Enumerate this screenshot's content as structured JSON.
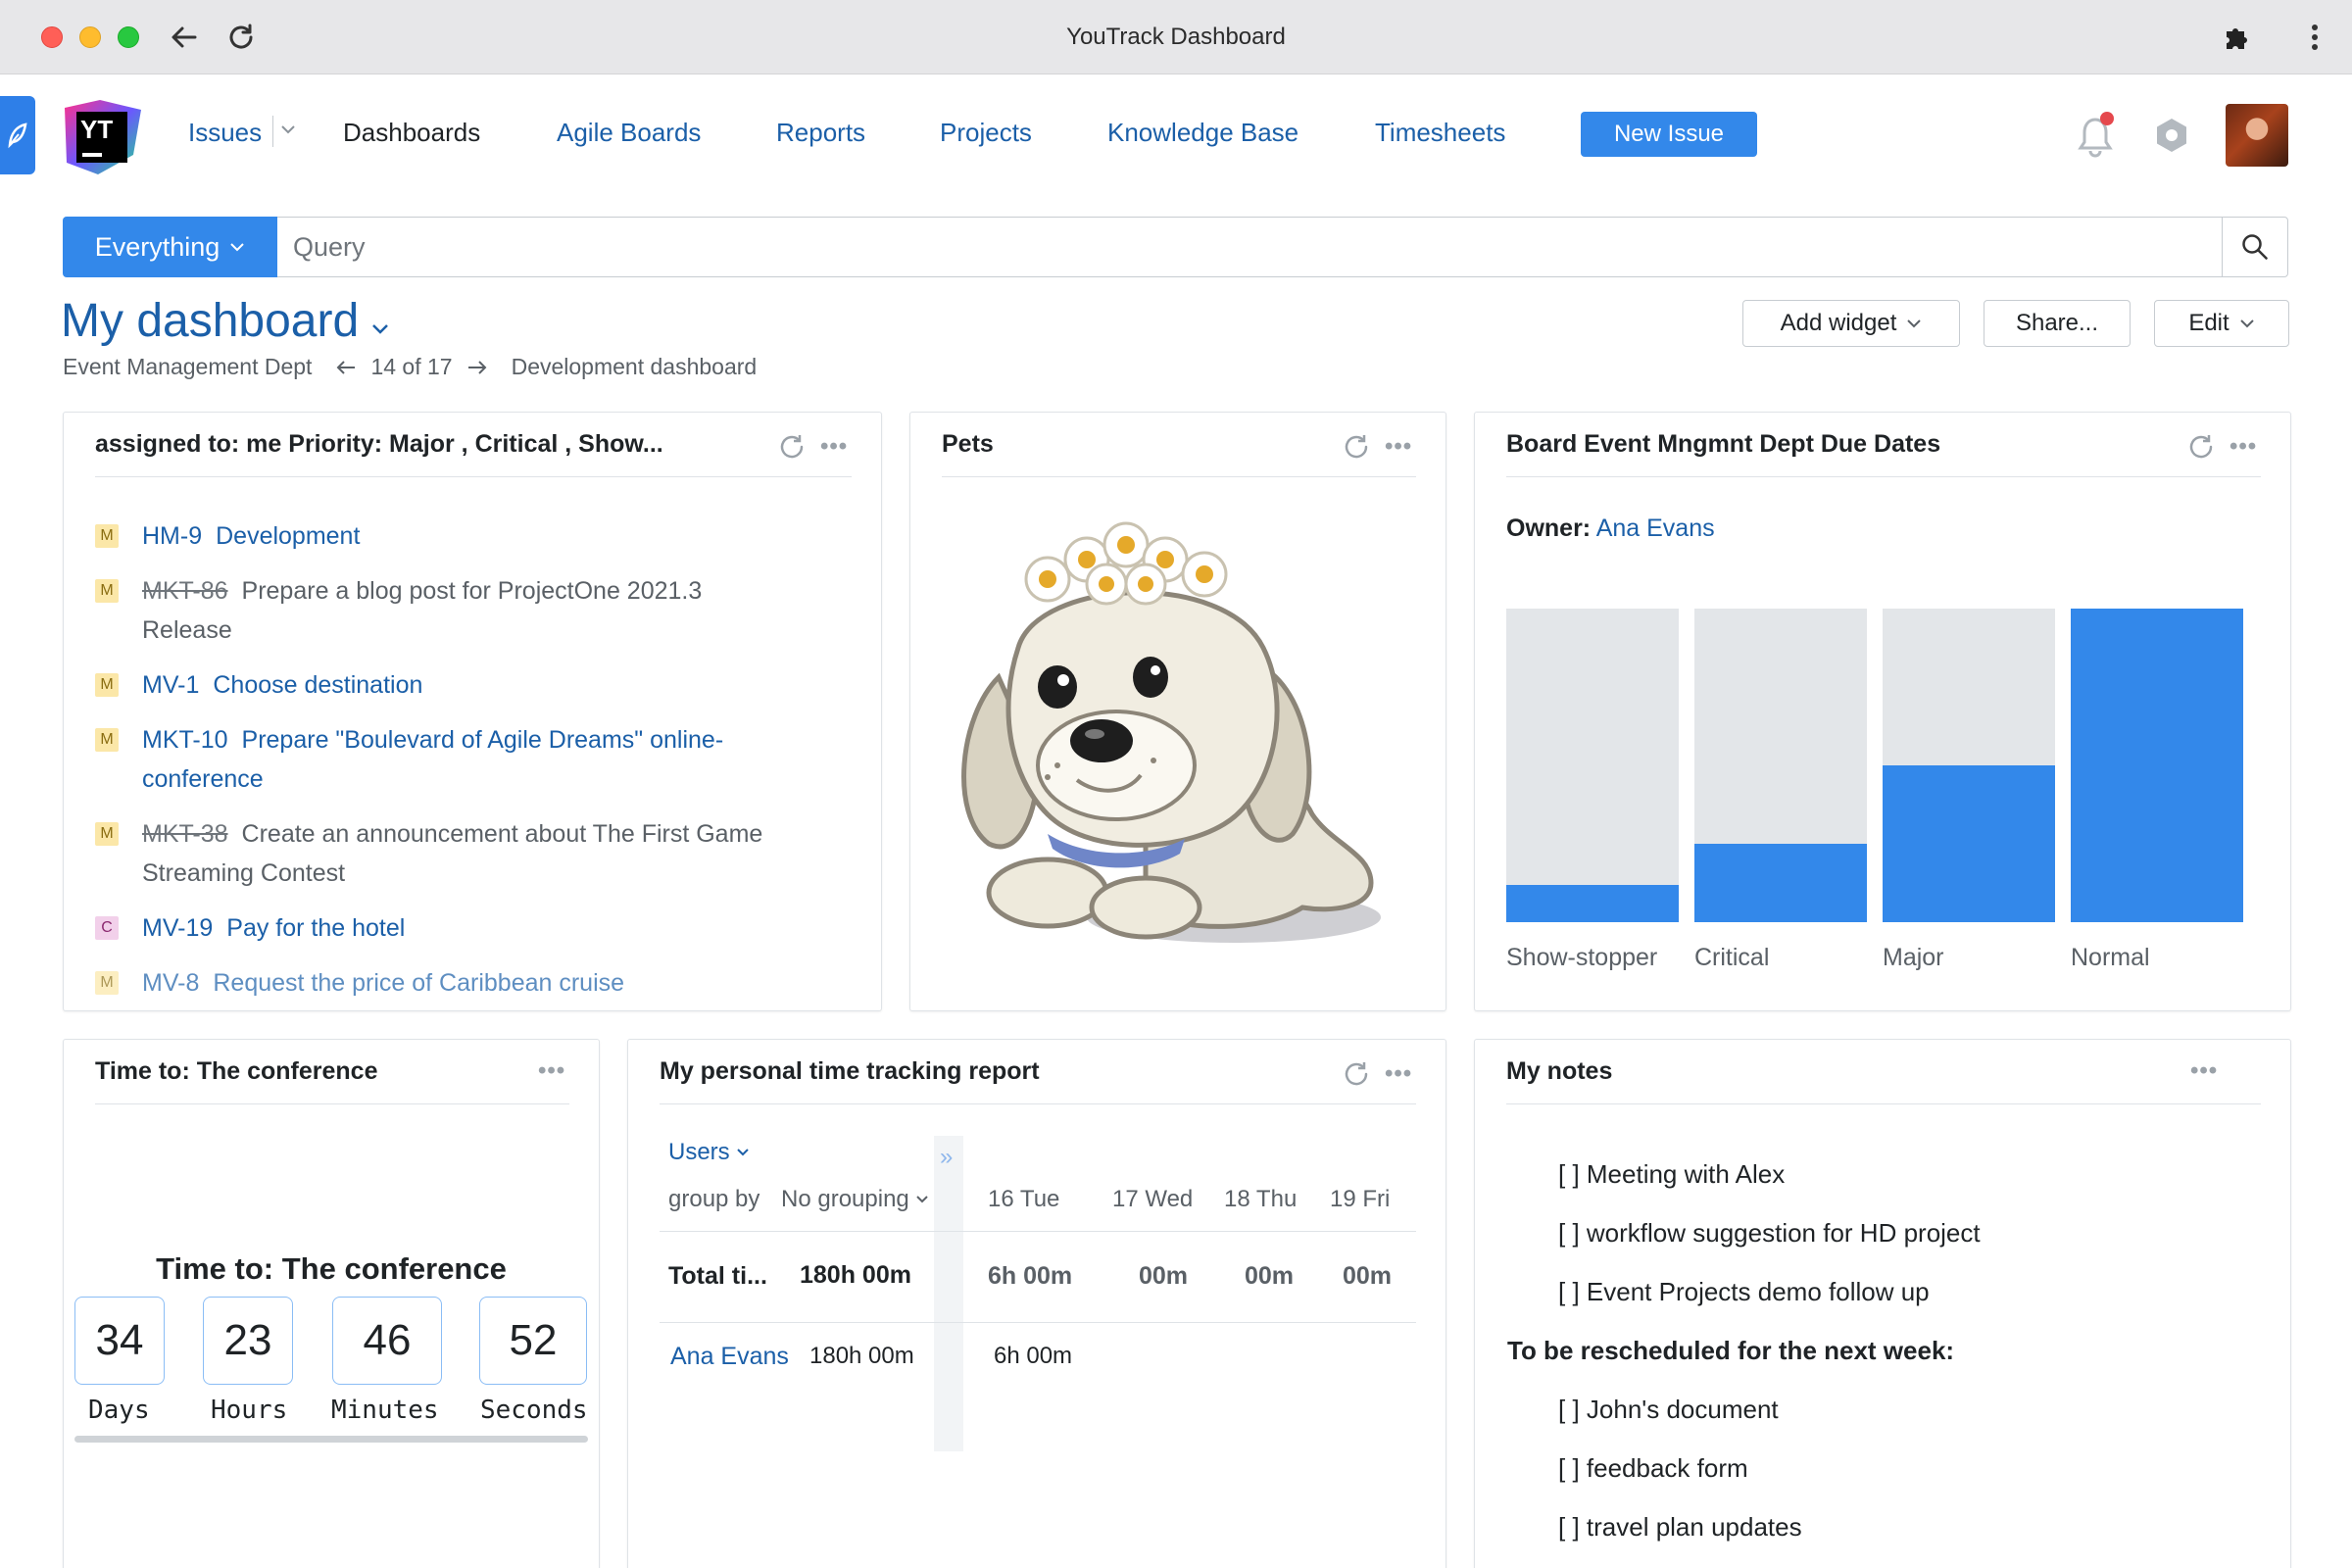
{
  "browser": {
    "title": "YouTrack Dashboard"
  },
  "nav": {
    "issues": "Issues",
    "dashboards": "Dashboards",
    "agile_boards": "Agile Boards",
    "reports": "Reports",
    "projects": "Projects",
    "knowledge_base": "Knowledge Base",
    "timesheets": "Timesheets",
    "new_issue": "New Issue",
    "logo_text": "YT"
  },
  "search": {
    "scope": "Everything",
    "placeholder": "Query"
  },
  "dashboard": {
    "title": "My dashboard",
    "dept": "Event Management Dept",
    "position": "14 of 17",
    "next_dashboard": "Development dashboard",
    "add_widget": "Add widget",
    "share": "Share...",
    "edit": "Edit"
  },
  "issues_widget": {
    "title": "assigned to: me Priority: Major , Critical , Show...",
    "items": [
      {
        "priority": "M",
        "id": "HM-9",
        "summary": "Development",
        "resolved": false
      },
      {
        "priority": "M",
        "id": "MKT-86",
        "summary": "Prepare a blog post for ProjectOne 2021.3",
        "summary2": "Release",
        "resolved": true
      },
      {
        "priority": "M",
        "id": "MV-1",
        "summary": "Choose destination",
        "resolved": false
      },
      {
        "priority": "M",
        "id": "MKT-10",
        "summary": "Prepare \"Boulevard of Agile Dreams\" online-",
        "summary2": "conference",
        "resolved": false
      },
      {
        "priority": "M",
        "id": "MKT-38",
        "summary": "Create an announcement about The First Game",
        "summary2": "Streaming Contest",
        "resolved": true
      },
      {
        "priority": "C",
        "id": "MV-19",
        "summary": "Pay for the hotel",
        "resolved": false
      },
      {
        "priority": "M",
        "id": "MV-8",
        "summary": "Request the price of Caribbean cruise",
        "resolved": false
      }
    ]
  },
  "pets_widget": {
    "title": "Pets"
  },
  "due_dates_widget": {
    "title": "Board Event Mngmnt Dept Due Dates",
    "owner_label": "Owner:",
    "owner_name": "Ana Evans"
  },
  "chart_data": {
    "type": "bar",
    "categories": [
      "Show-stopper",
      "Critical",
      "Major",
      "Normal"
    ],
    "values": [
      0.12,
      0.25,
      0.5,
      1.0
    ],
    "ylim": [
      0,
      1
    ],
    "colors": {
      "fill": "#3388ea",
      "track": "#e3e6e9"
    }
  },
  "countdown_widget": {
    "title": "Time to: The conference",
    "heading": "Time to: The conference",
    "units": [
      {
        "value": "34",
        "label": "Days"
      },
      {
        "value": "23",
        "label": "Hours"
      },
      {
        "value": "46",
        "label": "Minutes"
      },
      {
        "value": "52",
        "label": "Seconds"
      }
    ]
  },
  "time_widget": {
    "title": "My personal time tracking report",
    "users_label": "Users",
    "group_by_label": "group by",
    "grouping_value": "No grouping",
    "days": [
      "16 Tue",
      "17 Wed",
      "18 Thu",
      "19 Fri"
    ],
    "total_label": "Total ti...",
    "total_value": "180h 00m",
    "total_days": [
      "6h 00m",
      "00m",
      "00m",
      "00m"
    ],
    "user_name": "Ana Evans",
    "user_total": "180h 00m",
    "user_days": [
      "6h 00m"
    ]
  },
  "notes_widget": {
    "title": "My notes",
    "items": [
      "[ ] Meeting with Alex",
      "[ ] workflow suggestion for HD project",
      "[ ] Event Projects demo follow up"
    ],
    "heading": "To be rescheduled for the next week:",
    "items2": [
      "[ ] John's document",
      "[ ] feedback form",
      "[ ] travel plan updates"
    ]
  },
  "colors": {
    "accent": "#3388ea",
    "link": "#1b5fa8",
    "notification_dot": "#e5484d"
  }
}
